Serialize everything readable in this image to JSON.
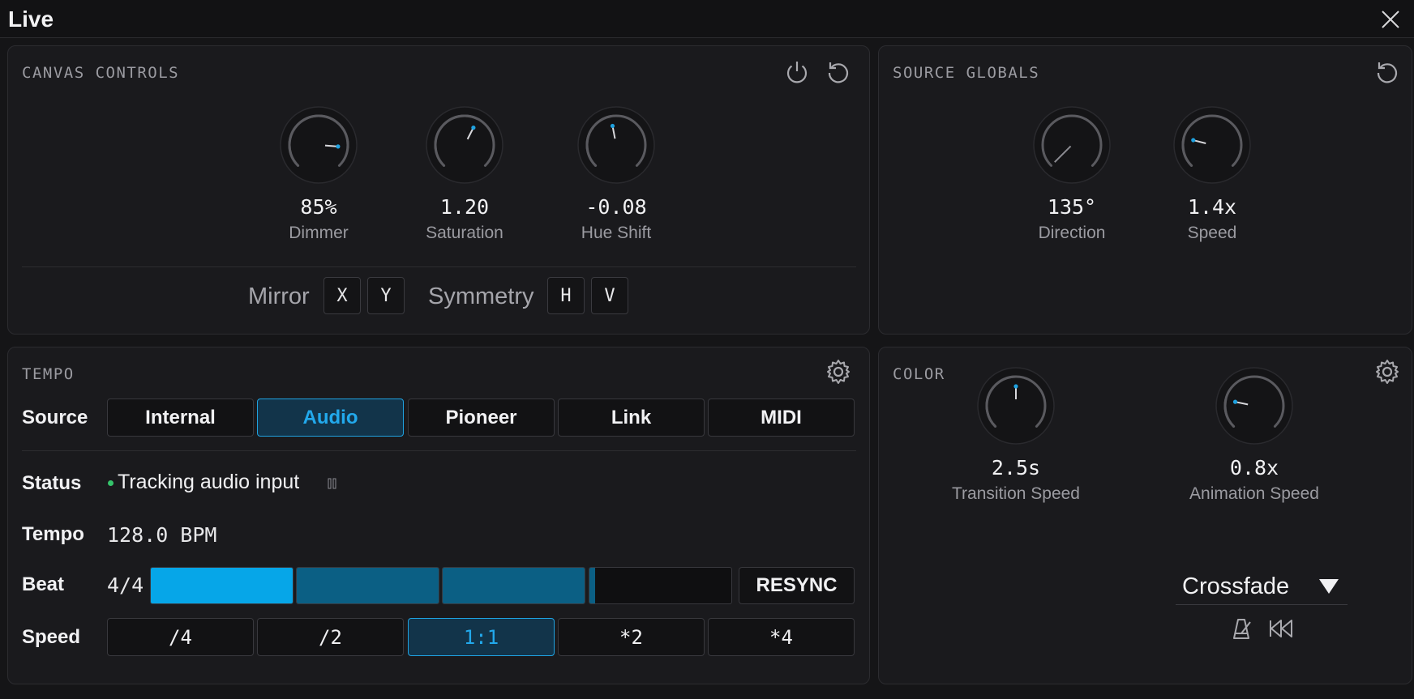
{
  "window": {
    "title": "Live"
  },
  "canvas_controls": {
    "title": "CANVAS CONTROLS",
    "knobs": [
      {
        "value": "85%",
        "label": "Dimmer",
        "level": 0.85
      },
      {
        "value": "1.20",
        "label": "Saturation",
        "level": 0.6
      },
      {
        "value": "-0.08",
        "label": "Hue Shift",
        "level": 0.46
      }
    ],
    "mirror_label": "Mirror",
    "mirror_x": "X",
    "mirror_y": "Y",
    "symmetry_label": "Symmetry",
    "symmetry_h": "H",
    "symmetry_v": "V"
  },
  "source_globals": {
    "title": "SOURCE GLOBALS",
    "knobs": [
      {
        "value": "135°",
        "label": "Direction",
        "level": 0.0
      },
      {
        "value": "1.4x",
        "label": "Speed",
        "level": 0.22
      }
    ]
  },
  "tempo": {
    "title": "TEMPO",
    "source_label": "Source",
    "sources": [
      "Internal",
      "Audio",
      "Pioneer",
      "Link",
      "MIDI"
    ],
    "active_source": 1,
    "status_label": "Status",
    "status_text": "Tracking audio input",
    "tempo_label": "Tempo",
    "tempo_value": "128.0 BPM",
    "beat_label": "Beat",
    "time_signature": "4/4",
    "beat_fill": [
      1,
      1,
      1,
      0.04
    ],
    "resync_label": "RESYNC",
    "speed_label": "Speed",
    "speeds": [
      "/4",
      "/2",
      "1:1",
      "*2",
      "*4"
    ],
    "active_speed": 2
  },
  "color": {
    "title": "COLOR",
    "knobs": [
      {
        "value": "2.5s",
        "label": "Transition Speed",
        "level": 0.5
      },
      {
        "value": "0.8x",
        "label": "Animation Speed",
        "level": 0.21
      }
    ],
    "transition_mode": "Crossfade"
  },
  "colors": {
    "accent": "#1fa2e0",
    "beat_active": "#06a6e8",
    "beat_dim": "#0b5f84",
    "status_ok": "#35c46b"
  }
}
